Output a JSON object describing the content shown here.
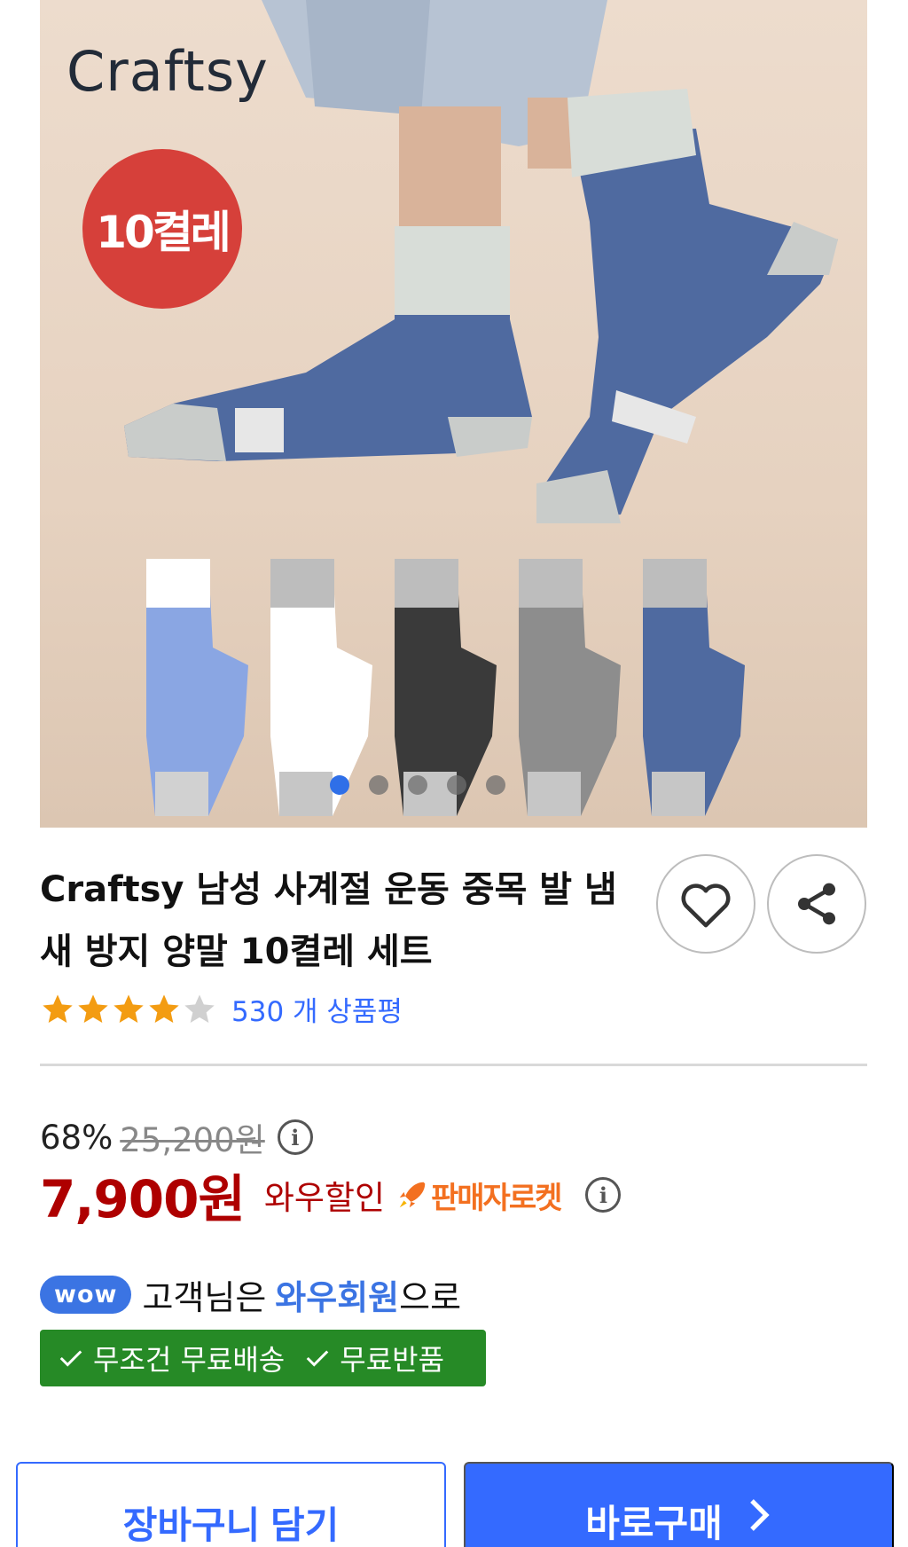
{
  "product_image": {
    "brand_logo": "Craftsy",
    "count_badge": "10켤레",
    "carousel": {
      "total": 5,
      "active": 1
    }
  },
  "product": {
    "title": "Craftsy 남성 사계절 운동 중목 발 냄새 방지 양말 10켤레 세트",
    "rating": 4,
    "review_text": "530 개 상품평"
  },
  "price": {
    "discount_rate": "68%",
    "original_price": "25,200원",
    "sale_price": "7,900원",
    "wow_discount_label": "와우할인",
    "rocket_label": "판매자로켓"
  },
  "wow": {
    "badge": "wow",
    "text_before": "고객님은",
    "member_text": "와우회원",
    "text_after": "으로"
  },
  "benefits": [
    "무조건 무료배송",
    "무료반품"
  ],
  "actions": {
    "cart_label": "장바구니 담기",
    "buy_label": "바로구매"
  },
  "colors": {
    "accent_blue": "#346aff",
    "price_red": "#ae0000",
    "rocket_orange": "#f37020",
    "benefit_green": "#268a26",
    "badge_red": "#d6403a",
    "star": "#f39c12"
  },
  "icons": [
    "heart-icon",
    "share-icon",
    "info-icon",
    "rocket-icon",
    "check-icon",
    "chevron-right-icon",
    "star-icon"
  ]
}
